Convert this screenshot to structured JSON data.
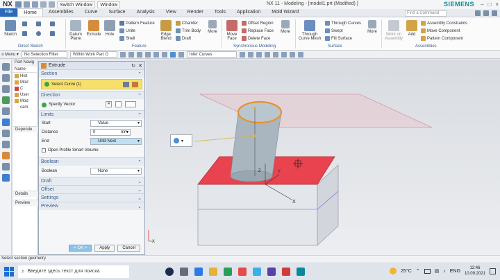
{
  "titlebar": {
    "logo": "NX",
    "switch_window": "Switch Window",
    "window": "Window",
    "title": "NX 11 - Modeling - [model1.prt (Modified) ]",
    "brand": "SIEMENS",
    "controls": [
      "–",
      "□",
      "×"
    ]
  },
  "menu": {
    "file": "File",
    "tabs": [
      "Home",
      "Assemblies",
      "Curve",
      "Surface",
      "Analysis",
      "View",
      "Render",
      "Tools",
      "Application",
      "Mold Wizard"
    ],
    "search_placeholder": "Find a Command"
  },
  "ribbon": {
    "sketch": "Sketch",
    "direct_sketch": "Direct Sketch",
    "datum_plane": "Datum\nPlane",
    "extrude": "Extrude",
    "hole": "Hole",
    "pattern_feature": "Pattern Feature",
    "unite": "Unite",
    "shell": "Shell",
    "feature": "Feature",
    "edge_blend": "Edge\nBlend",
    "chamfer": "Chamfer",
    "trim_body": "Trim Body",
    "draft": "Draft",
    "more": "More",
    "move_face": "Move\nFace",
    "offset_region": "Offset Region",
    "replace_face": "Replace Face",
    "delete_face": "Delete Face",
    "synchronous_modeling": "Synchronous Modeling",
    "through_curve_mesh": "Through\nCurve Mesh",
    "through_curves": "Through Curves",
    "swept": "Swept",
    "fill_surface": "Fill Surface",
    "surface": "Surface",
    "work_on_assembly": "Work on\nAssembly",
    "add": "Add",
    "assembly_constraints": "Assembly Constraints",
    "move_component": "Move Component",
    "pattern_component": "Pattern Component",
    "assemblies": "Assemblies"
  },
  "selbar": {
    "menu": "Menu",
    "filter": "No Selection Filter",
    "scope": "Within Work Part O",
    "curve_rule": "Infer Curves"
  },
  "navigator": {
    "title": "Part Navig",
    "col": "Name",
    "items": [
      "Hist",
      "Mod",
      "C",
      "User",
      "Mod",
      "cam"
    ],
    "dependents": "Depende",
    "details": "Details",
    "preview": "Preview"
  },
  "dialog": {
    "title": "Extrude",
    "section": "Section",
    "select_curve": "Select Curve (1)",
    "direction": "Direction",
    "specify_vector": "Specify Vector",
    "limits": "Limits",
    "start_label": "Start",
    "start_value": "Value",
    "distance_label": "Distance",
    "distance_value": "0",
    "distance_unit": "mm",
    "end_label": "End",
    "end_value": "Until Next",
    "open_profile": "Open Profile Smart Volume",
    "boolean": "Boolean",
    "boolean_label": "Boolean",
    "boolean_value": "None",
    "draft": "Draft",
    "offset": "Offset",
    "settings": "Settings",
    "preview": "Preview",
    "ok": "< OK >",
    "apply": "Apply",
    "cancel": "Cancel"
  },
  "viewport": {
    "axis_x": "X",
    "axis_y": "Y",
    "axis_z": "Z",
    "small_x": "X"
  },
  "status": "Select section geometry",
  "taskbar": {
    "search": "Введите здесь текст для поиска",
    "weather": "25°C",
    "lang": "ENG",
    "time": "12:46",
    "date": "10.09.2021"
  },
  "colors": {
    "accent": "#2a6ab8",
    "selected_face": "#e8434f",
    "selection_highlight": "#f6e06b",
    "cylinder": "#a9b6bf"
  }
}
